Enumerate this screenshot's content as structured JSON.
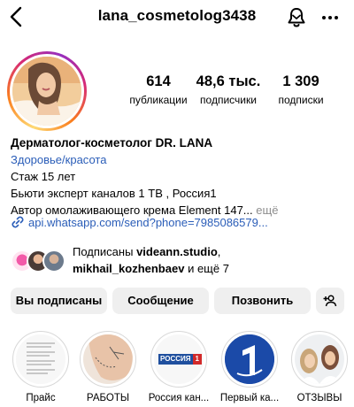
{
  "header": {
    "username": "lana_cosmetolog3438",
    "back_icon": "back-chevron-icon",
    "bell_icon": "bell-icon",
    "more_icon": "more-dots-icon"
  },
  "stats": {
    "posts_count": "614",
    "posts_label": "публикации",
    "followers_count": "48,6 тыс.",
    "followers_label": "подписчики",
    "following_count": "1 309",
    "following_label": "подписки"
  },
  "bio": {
    "name": "Дерматолог-косметолог DR. LANA",
    "category": "Здоровье/красота",
    "line1": "Стаж 15 лет",
    "line2": "Бьюти эксперт каналов 1 ТВ , Россия1",
    "line3": "Автор омолаживающего крема Element 147...",
    "more": "ещё",
    "link": "api.whatsapp.com/send?phone=7985086579..."
  },
  "followed_by": {
    "prefix": "Подписаны",
    "user1": "videann.studio",
    "user2": "mikhail_kozhenbaev",
    "suffix": "и ещё 7"
  },
  "buttons": {
    "following": "Вы подписаны",
    "message": "Сообщение",
    "call": "Позвонить"
  },
  "highlights": [
    {
      "label": "Прайс"
    },
    {
      "label": "РАБОТЫ"
    },
    {
      "label": "Россия кан..."
    },
    {
      "label": "Первый ка..."
    },
    {
      "label": "ОТЗЫВЫ"
    }
  ],
  "highlight_texts": {
    "russia_logo": "РОССИЯ",
    "russia_digit": "1"
  },
  "colors": {
    "link": "#2a5db8",
    "button_bg": "#efefef",
    "channel_one_blue": "#1b4aa8"
  }
}
